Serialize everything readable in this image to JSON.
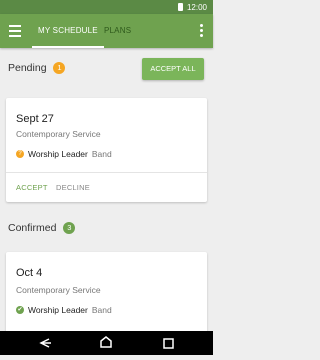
{
  "status_bar": {
    "time": "12:00"
  },
  "app_bar": {
    "tabs": [
      {
        "label": "MY SCHEDULE",
        "active": true
      },
      {
        "label": "PLANS",
        "active": false
      }
    ]
  },
  "pending": {
    "label": "Pending",
    "count": "1",
    "accept_all_label": "ACCEPT ALL",
    "items": [
      {
        "date": "Sept 27",
        "service": "Contemporary Service",
        "role": "Worship Leader",
        "team": "Band",
        "status_icon": "?",
        "accept_label": "ACCEPT",
        "decline_label": "DECLINE"
      }
    ]
  },
  "confirmed": {
    "label": "Confirmed",
    "count": "3",
    "items": [
      {
        "date": "Oct 4",
        "service": "Contemporary Service",
        "role": "Worship Leader",
        "team": "Band",
        "status_icon": "✔"
      }
    ]
  },
  "colors": {
    "primary": "#6fa24f",
    "status_bar": "#5b8a45",
    "pending_badge": "#f5a623",
    "accent_button": "#7bb55a"
  },
  "icons": {
    "menu": "hamburger-menu-icon",
    "overflow": "overflow-menu-icon",
    "back": "back-icon",
    "home": "home-icon",
    "recents": "recents-icon"
  }
}
